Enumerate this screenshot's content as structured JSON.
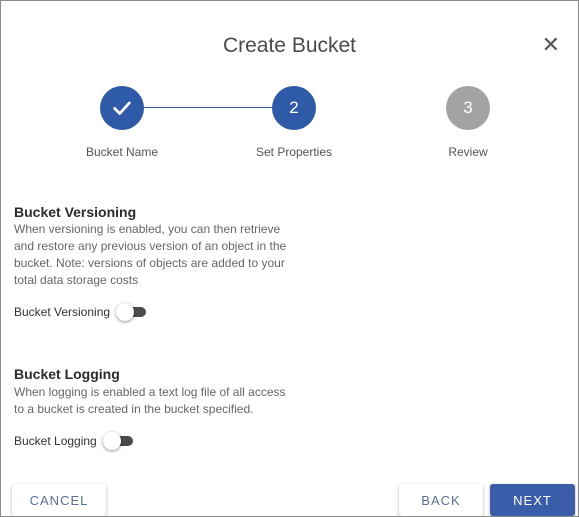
{
  "dialog": {
    "title": "Create Bucket",
    "close_glyph": "✕"
  },
  "stepper": {
    "steps": [
      {
        "label": "Bucket Name",
        "number": "",
        "state": "complete",
        "icon": "checkmark-icon"
      },
      {
        "label": "Set Properties",
        "number": "2",
        "state": "active"
      },
      {
        "label": "Review",
        "number": "3",
        "state": "pending"
      }
    ]
  },
  "versioning": {
    "title": "Bucket Versioning",
    "description": "When versioning is enabled, you can then retrieve and restore any previous version of an object in the bucket. Note: versions of objects are added to your total data storage costs",
    "toggle_label": "Bucket Versioning",
    "enabled": false
  },
  "logging": {
    "title": "Bucket Logging",
    "description": "When logging is enabled a text log file of all access to a bucket is created in the bucket specified.",
    "toggle_label": "Bucket Logging",
    "enabled": false
  },
  "footer": {
    "cancel_label": "CANCEL",
    "back_label": "BACK",
    "next_label": "NEXT"
  },
  "colors": {
    "primary": "#2f5aa8",
    "pending": "#a3a3a3"
  }
}
